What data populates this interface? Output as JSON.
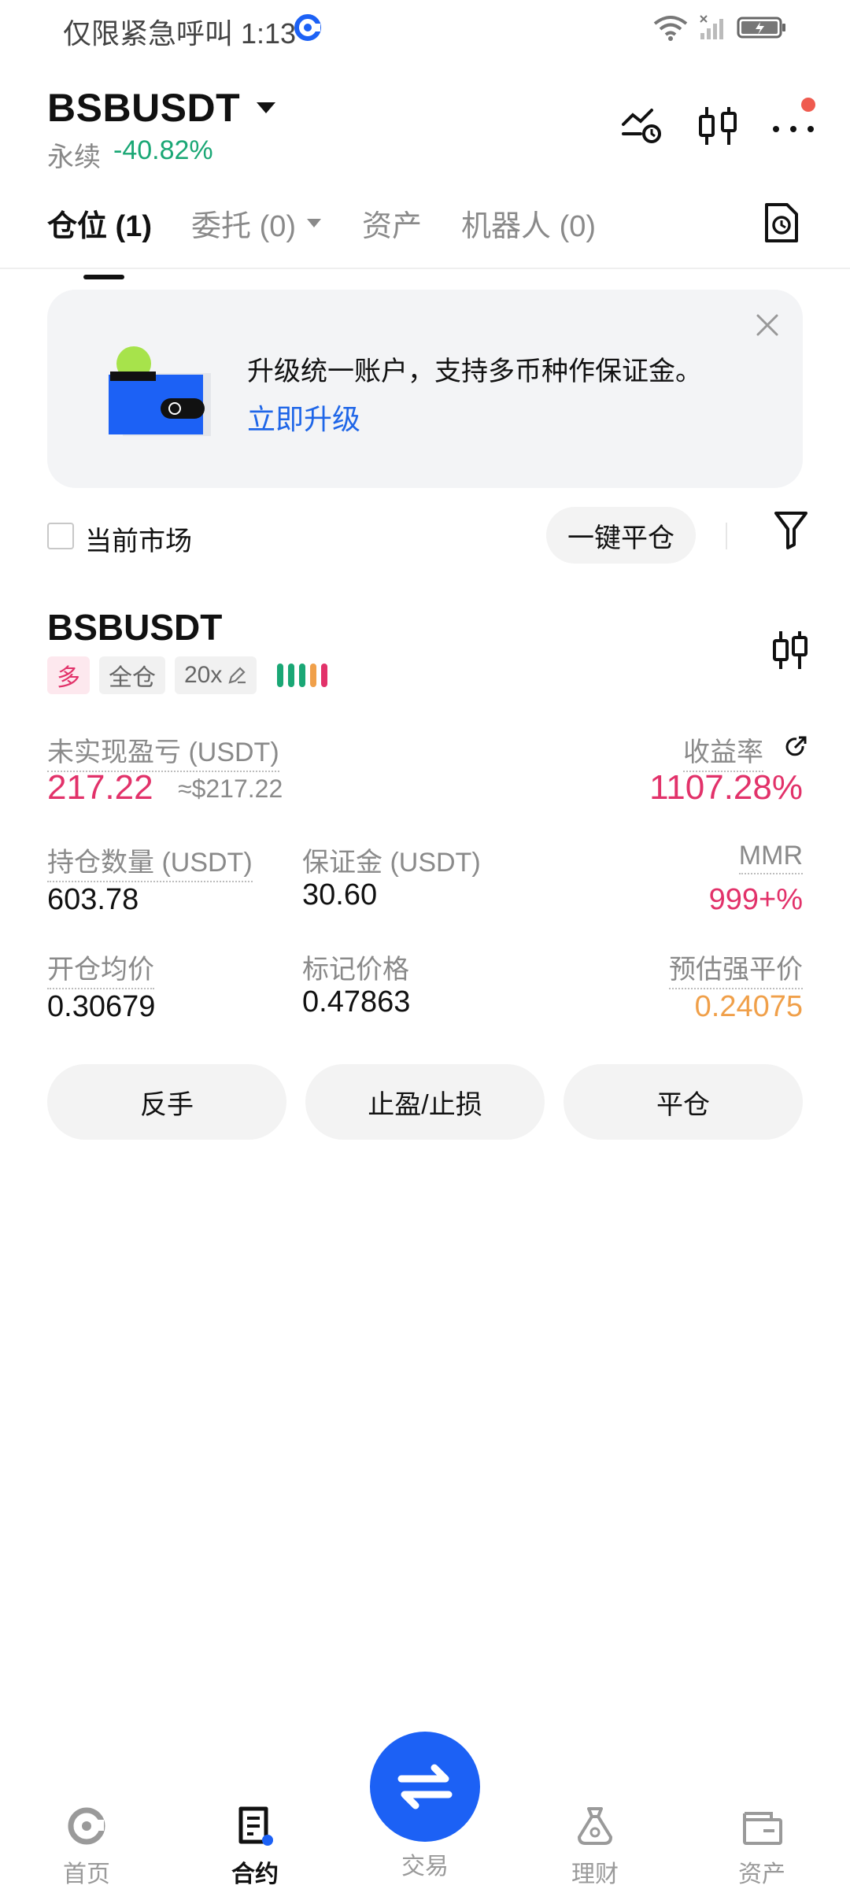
{
  "status_bar": {
    "text": "仅限紧急呼叫 1:13"
  },
  "header": {
    "pair": "BSBUSDT",
    "perp_label": "永续",
    "change_pct": "-40.82%"
  },
  "tabs": [
    {
      "label": "仓位 (1)"
    },
    {
      "label": "委托 (0)"
    },
    {
      "label": "资产"
    },
    {
      "label": "机器人 (0)"
    }
  ],
  "banner": {
    "text": "升级统一账户，支持多币种作保证金。",
    "link": "立即升级"
  },
  "filter": {
    "checkbox_label": "当前市场",
    "close_all_label": "一键平仓"
  },
  "position": {
    "symbol": "BSBUSDT",
    "tag_side": "多",
    "tag_margin": "全仓",
    "tag_leverage": "20x",
    "leverage_bar_colors": [
      "#1aa775",
      "#1aa775",
      "#1aa775",
      "#f0a04a",
      "#e2326a"
    ],
    "unrealized_label": "未实现盈亏 (USDT)",
    "unrealized_value": "217.22",
    "unrealized_approx": "≈$217.22",
    "roi_label": "收益率",
    "roi_value": "1107.28%",
    "size_label": "持仓数量 (USDT)",
    "size_value": "603.78",
    "margin_label": "保证金 (USDT)",
    "margin_value": "30.60",
    "mmr_label": "MMR",
    "mmr_value": "999+%",
    "entry_label": "开仓均价",
    "entry_value": "0.30679",
    "mark_label": "标记价格",
    "mark_value": "0.47863",
    "liq_label": "预估强平价",
    "liq_value": "0.24075",
    "btn_reverse": "反手",
    "btn_tpsl": "止盈/止损",
    "btn_close": "平仓"
  },
  "bottom_nav": {
    "home": "首页",
    "futures": "合约",
    "trade": "交易",
    "earn": "理财",
    "assets": "资产"
  },
  "colors": {
    "accent": "#1c61f5",
    "green": "#1aa775",
    "red": "#e2326a",
    "orange": "#f0a04a"
  }
}
